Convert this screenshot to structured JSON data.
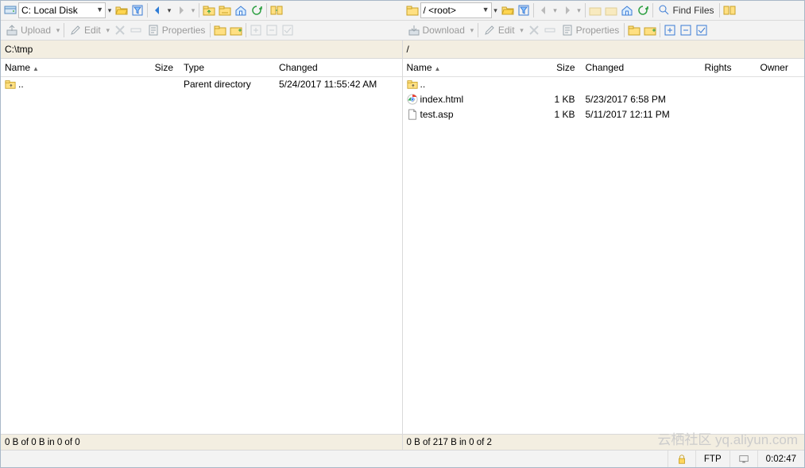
{
  "left": {
    "drive_label": "C: Local Disk",
    "path": "C:\\tmp",
    "columns": [
      "Name",
      "Size",
      "Type",
      "Changed"
    ],
    "rows": [
      {
        "icon": "up",
        "name": "..",
        "size": "",
        "type": "Parent directory",
        "changed": "5/24/2017  11:55:42 AM"
      }
    ],
    "status": "0 B of 0 B in 0 of 0",
    "upload_label": "Upload",
    "edit_label": "Edit",
    "properties_label": "Properties"
  },
  "right": {
    "drive_label": "/ <root>",
    "path": "/",
    "columns": [
      "Name",
      "Size",
      "Changed",
      "Rights",
      "Owner"
    ],
    "rows": [
      {
        "icon": "up",
        "name": "..",
        "size": "",
        "changed": "",
        "rights": "",
        "owner": ""
      },
      {
        "icon": "chrome",
        "name": "index.html",
        "size": "1 KB",
        "changed": "5/23/2017 6:58 PM",
        "rights": "",
        "owner": ""
      },
      {
        "icon": "file",
        "name": "test.asp",
        "size": "1 KB",
        "changed": "5/11/2017 12:11 PM",
        "rights": "",
        "owner": ""
      }
    ],
    "status": "0 B of 217 B in 0 of 2",
    "download_label": "Download",
    "edit_label": "Edit",
    "properties_label": "Properties",
    "find_files_label": "Find Files"
  },
  "footer": {
    "protocol": "FTP",
    "elapsed": "0:02:47"
  },
  "watermark": "云栖社区 yq.aliyun.com"
}
